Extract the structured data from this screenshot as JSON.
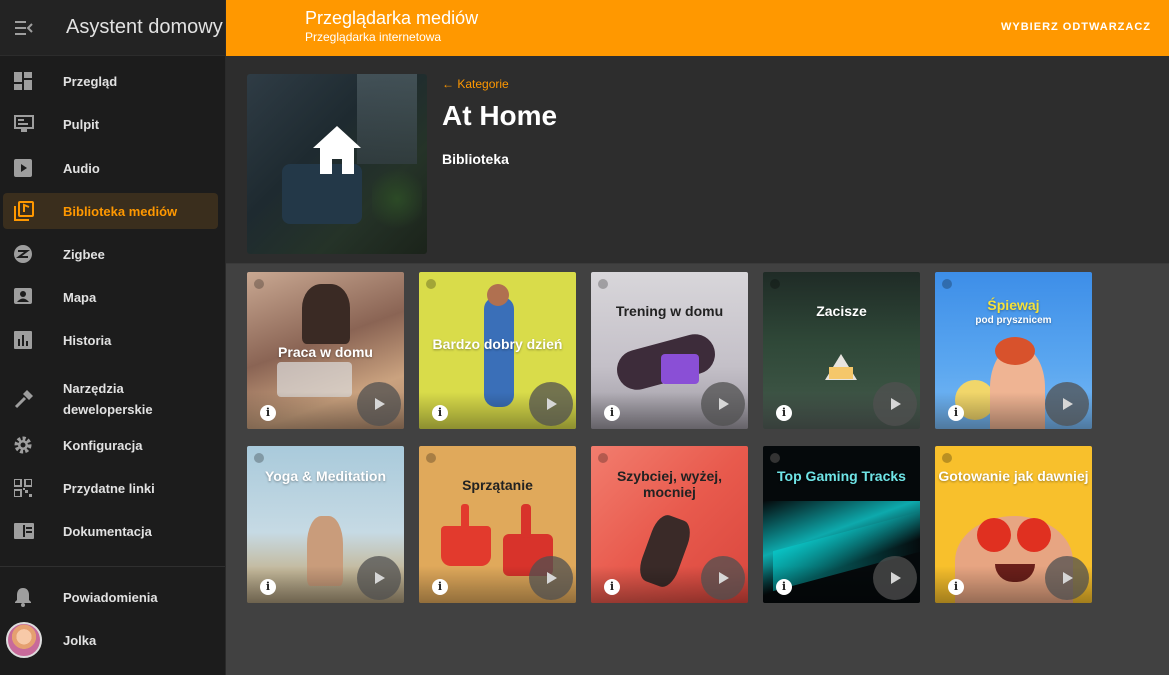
{
  "sidebar": {
    "title": "Asystent domowy",
    "items": [
      {
        "label": "Przegląd",
        "icon": "dashboard-icon"
      },
      {
        "label": "Pulpit",
        "icon": "monitor-icon"
      },
      {
        "label": "Audio",
        "icon": "play-box-icon"
      },
      {
        "label": "Biblioteka mediów",
        "icon": "media-library-icon",
        "active": true
      },
      {
        "label": "Zigbee",
        "icon": "zigbee-icon"
      },
      {
        "label": "Mapa",
        "icon": "account-box-icon"
      },
      {
        "label": "Historia",
        "icon": "chart-bar-icon"
      },
      {
        "label": "Narzędzia deweloperskie",
        "icon": "hammer-icon"
      },
      {
        "label": "Konfiguracja",
        "icon": "cog-icon"
      },
      {
        "label": "Przydatne linki",
        "icon": "qrcode-icon"
      },
      {
        "label": "Dokumentacja",
        "icon": "book-icon"
      }
    ],
    "notifications_label": "Powiadomienia",
    "user_name": "Jolka"
  },
  "topbar": {
    "title": "Przeglądarka mediów",
    "subtitle": "Przeglądarka internetowa",
    "action": "WYBIERZ ODTWARZACZ"
  },
  "header": {
    "back_label": "Kategorie",
    "title": "At Home",
    "subtitle": "Biblioteka"
  },
  "playlists": [
    {
      "title": "Praca w domu",
      "subtitle": ""
    },
    {
      "title": "Bardzo dobry dzień",
      "subtitle": ""
    },
    {
      "title": "Trening w domu",
      "subtitle": ""
    },
    {
      "title": "Zacisze",
      "subtitle": ""
    },
    {
      "title": "Śpiewaj",
      "subtitle": "pod prysznicem"
    },
    {
      "title": "Yoga & Meditation",
      "subtitle": ""
    },
    {
      "title": "Sprzątanie",
      "subtitle": ""
    },
    {
      "title": "Szybciej, wyżej, mocniej",
      "subtitle": ""
    },
    {
      "title": "Top Gaming Tracks",
      "subtitle": ""
    },
    {
      "title": "Gotowanie jak dawniej",
      "subtitle": ""
    }
  ],
  "colors": {
    "accent": "#ff9800",
    "sidebar_bg": "#1c1c1c",
    "content_bg": "#414141"
  }
}
